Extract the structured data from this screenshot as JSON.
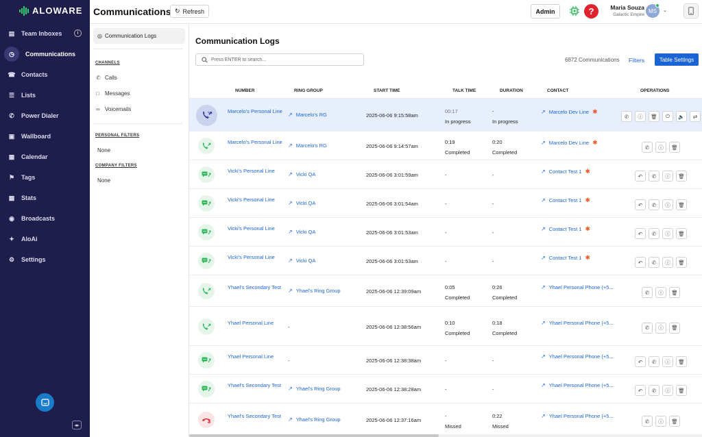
{
  "brand": {
    "name": "ALOWARE"
  },
  "nav": {
    "items": [
      {
        "label": "Team Inboxes",
        "icon": "inbox-icon"
      },
      {
        "label": "Communications",
        "icon": "clock-icon"
      },
      {
        "label": "Contacts",
        "icon": "contacts-icon"
      },
      {
        "label": "Lists",
        "icon": "list-icon"
      },
      {
        "label": "Power Dialer",
        "icon": "dialer-icon"
      },
      {
        "label": "Wallboard",
        "icon": "wallboard-icon"
      },
      {
        "label": "Calendar",
        "icon": "calendar-icon"
      },
      {
        "label": "Tags",
        "icon": "tag-icon"
      },
      {
        "label": "Stats",
        "icon": "stats-icon"
      },
      {
        "label": "Broadcasts",
        "icon": "broadcast-icon"
      },
      {
        "label": "AloAi",
        "icon": "ai-icon"
      },
      {
        "label": "Settings",
        "icon": "gear-icon"
      }
    ]
  },
  "header": {
    "title": "Communications",
    "refresh_label": "Refresh",
    "admin_label": "Admin",
    "help_label": "?",
    "user_name": "Maria Souza",
    "user_org": "Galactic Empire",
    "avatar_initials": "MS"
  },
  "filters": {
    "active_label": "Communication Logs",
    "channels_label": "CHANNELS",
    "channels": [
      "Calls",
      "Messages",
      "Voicemails"
    ],
    "personal_label": "PERSONAL FILTERS",
    "personal_value": "None",
    "company_label": "COMPANY FILTERS",
    "company_value": "None"
  },
  "main": {
    "title": "Communication Logs",
    "search_placeholder": "Press ENTER to search...",
    "count": "6872 Communications",
    "filters_link": "Filters",
    "settings_button": "Table Settings",
    "columns": [
      "NUMBER",
      "RING GROUP",
      "START TIME",
      "TALK TIME",
      "DURATION",
      "CONTACT",
      "OPERATIONS"
    ],
    "rows": [
      {
        "type": "call",
        "number": "Marcelo's Personal Line",
        "ring_group": "Marcelo's RG",
        "start": "2025-06-06 9:15:58am",
        "talk": "00:17",
        "talk_status": "In progress",
        "duration": "-",
        "duration_status": "In progress",
        "contact": "Marcelo Dev Line",
        "hubspot": true
      },
      {
        "type": "call",
        "number": "Marcelo's Personal Line",
        "ring_group": "Marcelo's RG",
        "start": "2025-06-06 9:14:57am",
        "talk": "0:19",
        "talk_status": "Completed",
        "duration": "0:20",
        "duration_status": "Completed",
        "contact": "Marcelo Dev Line",
        "hubspot": true
      },
      {
        "type": "sms",
        "number": "Vicki's Personal Line",
        "ring_group": "Vicki QA",
        "start": "2025-06-06 3:01:59am",
        "talk": "-",
        "talk_status": "",
        "duration": "-",
        "duration_status": "",
        "contact": "Contact Test 1",
        "hubspot": true
      },
      {
        "type": "sms",
        "number": "Vicki's Personal Line",
        "ring_group": "Vicki QA",
        "start": "2025-06-06 3:01:54am",
        "talk": "-",
        "talk_status": "",
        "duration": "-",
        "duration_status": "",
        "contact": "Contact Test 1",
        "hubspot": true
      },
      {
        "type": "sms",
        "number": "Vicki's Personal Line",
        "ring_group": "Vicki QA",
        "start": "2025-06-06 3:01:53am",
        "talk": "-",
        "talk_status": "",
        "duration": "-",
        "duration_status": "",
        "contact": "Contact Test 1",
        "hubspot": true
      },
      {
        "type": "sms",
        "number": "Vicki's Personal Line",
        "ring_group": "Vicki QA",
        "start": "2025-06-06 3:01:53am",
        "talk": "-",
        "talk_status": "",
        "duration": "-",
        "duration_status": "",
        "contact": "Contact Test 1",
        "hubspot": true
      },
      {
        "type": "call",
        "number": "Yhael's Secondary Test",
        "ring_group": "Yhael's Ring Group",
        "start": "2025-06-06 12:39:09am",
        "talk": "0:05",
        "talk_status": "Completed",
        "duration": "0:26",
        "duration_status": "Completed",
        "contact": "Yhael Personal Phone (+5...",
        "hubspot": false
      },
      {
        "type": "call",
        "number": "Yhael Personal Line",
        "ring_group": "-",
        "start": "2025-06-06 12:38:56am",
        "talk": "0:10",
        "talk_status": "Completed",
        "duration": "0:18",
        "duration_status": "Completed",
        "contact": "Yhael Personal Phone (+5...",
        "hubspot": false
      },
      {
        "type": "sms",
        "number": "Yhael Personal Line",
        "ring_group": "-",
        "start": "2025-06-06 12:38:38am",
        "talk": "-",
        "talk_status": "",
        "duration": "-",
        "duration_status": "",
        "contact": "Yhael Personal Phone (+5...",
        "hubspot": false
      },
      {
        "type": "sms",
        "number": "Yhael's Secondary Test",
        "ring_group": "Yhael's Ring Group",
        "start": "2025-06-06 12:38:28am",
        "talk": "-",
        "talk_status": "",
        "duration": "-",
        "duration_status": "",
        "contact": "Yhael Personal Phone (+5...",
        "hubspot": false
      },
      {
        "type": "missed",
        "number": "Yhael's Secondary Test",
        "ring_group": "Yhael's Ring Group",
        "start": "2025-06-06 12:37:16am",
        "talk": "-",
        "talk_status": "Missed",
        "duration": "0:22",
        "duration_status": "Missed",
        "contact": "Yhael Personal Phone (+5...",
        "hubspot": false
      }
    ]
  },
  "colors": {
    "nav_bg": "#1e1d4b",
    "accent": "#1a64d6",
    "success": "#2eb85c",
    "danger": "#e0232e",
    "hubspot": "#ee5a29"
  }
}
